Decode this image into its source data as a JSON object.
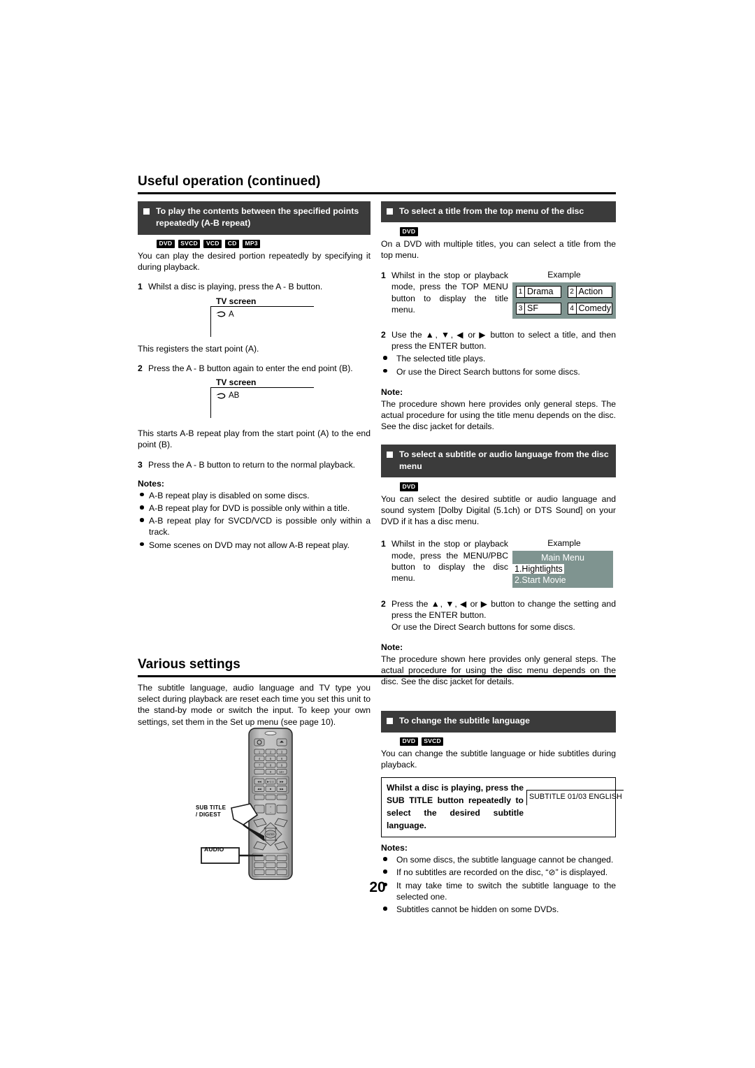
{
  "page": {
    "title": "Useful operation (continued)",
    "number": "20"
  },
  "left_column": {
    "section_ab_repeat": {
      "heading": "To play the contents between the specified points repeatedly (A-B repeat)",
      "badges": [
        "DVD",
        "SVCD",
        "VCD",
        "CD",
        "MP3"
      ],
      "intro": "You can play the desired portion repeatedly by specifying it during playback.",
      "steps": [
        {
          "n": "1",
          "text": "Whilst a disc is playing, press the A - B button."
        },
        {
          "n": "2",
          "text": "Press the A - B button again to enter the end point (B)."
        },
        {
          "n": "3",
          "text": "Press the A - B button to return to the normal playback."
        }
      ],
      "figure1": {
        "label": "TV screen",
        "indicator": "A"
      },
      "figure1_caption": "This registers the start point (A).",
      "figure2": {
        "label": "TV screen",
        "indicator": "AB"
      },
      "figure2_caption": "This starts A-B repeat play from the start point (A) to the end point (B).",
      "notes_heading": "Notes:",
      "notes": [
        "A-B repeat play is disabled on some discs.",
        "A-B repeat play for DVD is possible only within a title.",
        "A-B repeat play for SVCD/VCD is possible only within a track.",
        "Some scenes on DVD may not allow A-B repeat play."
      ]
    }
  },
  "right_column": {
    "section_top_menu": {
      "heading": "To select a title from the top menu of the disc",
      "badges": [
        "DVD"
      ],
      "intro": "On a DVD with multiple titles, you can select a title from the top menu.",
      "step1": {
        "n": "1",
        "text": "Whilst in the stop or playback mode, press the TOP MENU button to display the title menu."
      },
      "example_caption": "Example",
      "example_cells": [
        {
          "num": "1",
          "name": "Drama"
        },
        {
          "num": "2",
          "name": "Action"
        },
        {
          "num": "3",
          "name": "SF"
        },
        {
          "num": "4",
          "name": "Comedy"
        }
      ],
      "step2": {
        "n": "2",
        "text": "Use the ▲, ▼, ◀ or ▶ button to select a title, and then press the ENTER button."
      },
      "step2_bullets": [
        "The selected title plays.",
        "Or use the Direct Search buttons for some discs."
      ],
      "note_heading": "Note:",
      "note_text": "The procedure shown here provides only general steps. The actual procedure for using the title menu depends on the disc. See the disc jacket for details."
    },
    "section_disc_menu": {
      "heading": "To select a subtitle or audio language from the disc menu",
      "badges": [
        "DVD"
      ],
      "intro": "You can select the desired subtitle or audio language and sound system [Dolby Digital (5.1ch) or DTS Sound] on your DVD if it has a disc menu.",
      "step1": {
        "n": "1",
        "text": "Whilst in the stop or playback mode, press the MENU/PBC button to display the disc menu."
      },
      "example_caption": "Example",
      "example_menu": {
        "title": "Main Menu",
        "items": [
          "1.Hightlights",
          "2.Start Movie"
        ],
        "selected_index": 0
      },
      "step2": {
        "n": "2",
        "text": "Press the ▲, ▼, ◀ or ▶ button to change the setting and press the ENTER button."
      },
      "step2_extra": "Or use the Direct Search buttons for some discs.",
      "note_heading": "Note:",
      "note_text": "The procedure shown here provides only general steps. The actual procedure for using the disc menu depends on the disc. See the disc jacket for details."
    },
    "section_subtitle_language": {
      "heading": "To change the subtitle language",
      "badges": [
        "DVD",
        "SVCD"
      ],
      "intro": "You can change the subtitle language or hide subtitles during playback.",
      "boxed_instruction": "Whilst a disc is playing, press the SUB TITLE button repeatedly to select the desired subtitle language.",
      "osd_display": "SUBTITLE 01/03 ENGLISH",
      "notes_heading": "Notes:",
      "notes": [
        "On some discs, the subtitle language cannot be changed.",
        "If no subtitles are recorded on the disc, “⊘” is displayed.",
        "It may take time to switch the subtitle language to the selected one.",
        "Subtitles cannot be hidden on some DVDs."
      ]
    }
  },
  "various_settings": {
    "title": "Various settings",
    "body": "The subtitle language, audio language and TV type you select during playback are reset each time you set this unit to the stand-by mode or switch the input. To keep your own settings, set them in the Set up menu (see page 10).",
    "remote_callouts": {
      "subtitle": "SUB TITLE\n/ DIGEST",
      "subtitle_line1": "SUB TITLE",
      "subtitle_line2": "/ DIGEST",
      "audio": "AUDIO"
    }
  },
  "colors": {
    "header_bar": "#3b3b3b",
    "osd_background": "#7f9490",
    "text": "#000000"
  }
}
